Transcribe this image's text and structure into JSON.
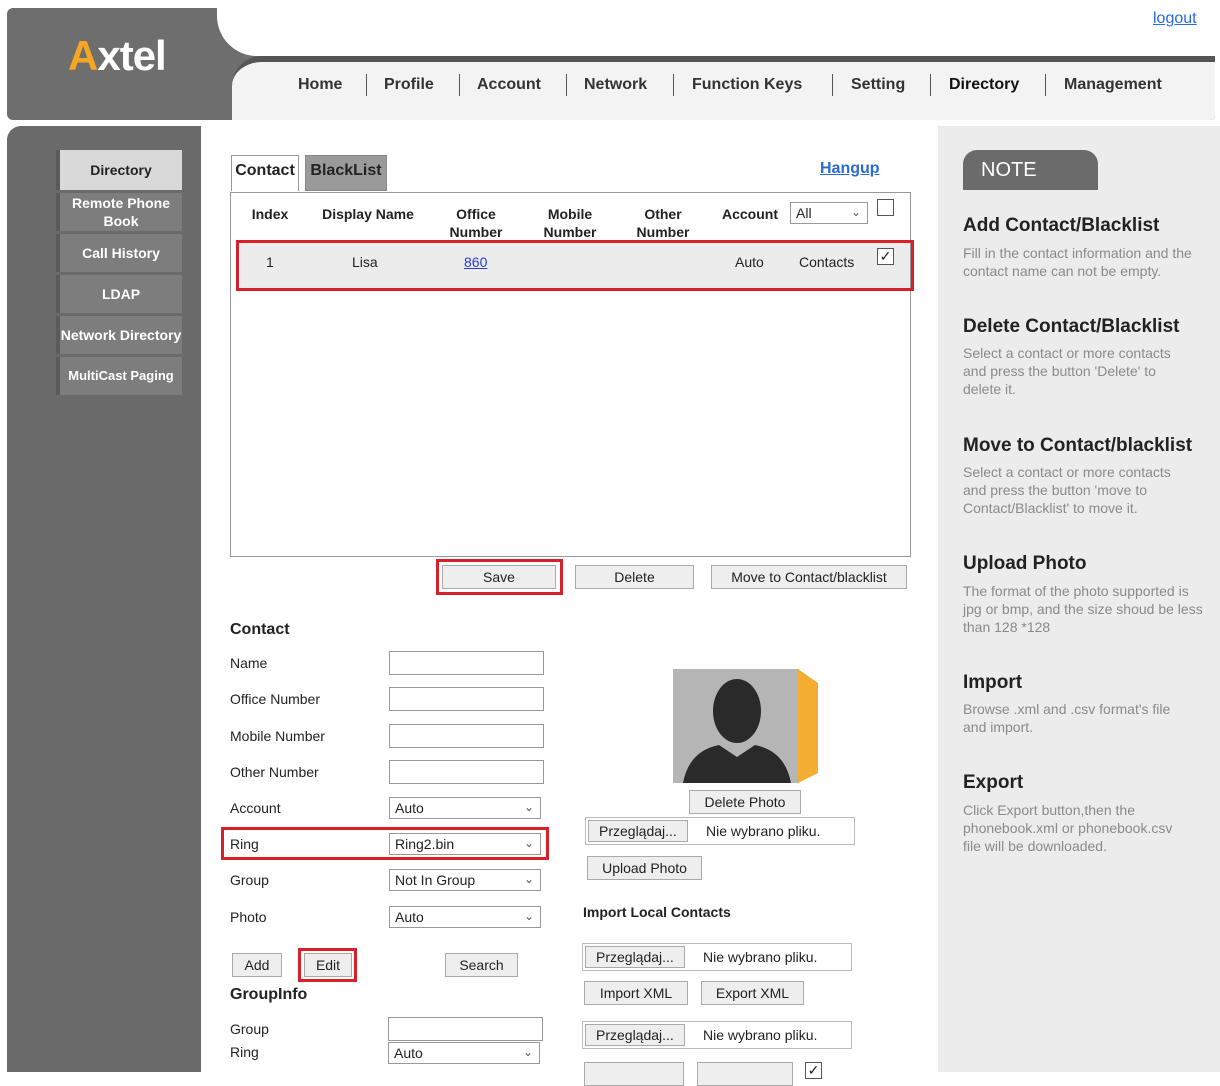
{
  "header": {
    "logo": {
      "accent": "A",
      "rest": "xtel",
      "accent_color": "#f5a623"
    },
    "logout": "logout",
    "nav": [
      "Home",
      "Profile",
      "Account",
      "Network",
      "Function Keys",
      "Setting",
      "Directory",
      "Management"
    ]
  },
  "sidebar": {
    "items": [
      {
        "label": "Directory",
        "active": true
      },
      {
        "label": "Remote Phone Book"
      },
      {
        "label": "Call History"
      },
      {
        "label": "LDAP"
      },
      {
        "label": "Network Directory"
      },
      {
        "label": "MultiCast Paging"
      }
    ]
  },
  "tabs": {
    "contact": "Contact",
    "blacklist": "BlackList",
    "hangup": "Hangup"
  },
  "table": {
    "headers": [
      "Index",
      "Display Name",
      "Office Number",
      "Mobile Number",
      "Other Number",
      "Account"
    ],
    "account_filter": "All",
    "rows": [
      {
        "index": "1",
        "name": "Lisa",
        "office": "860",
        "mobile": "",
        "other": "",
        "account": "Auto",
        "group": "Contacts",
        "checked": true
      }
    ]
  },
  "actions": {
    "save": "Save",
    "delete": "Delete",
    "move": "Move to Contact/blacklist"
  },
  "contact_form": {
    "title": "Contact",
    "name_label": "Name",
    "office_label": "Office Number",
    "mobile_label": "Mobile Number",
    "other_label": "Other Number",
    "account_label": "Account",
    "account_value": "Auto",
    "ring_label": "Ring",
    "ring_value": "Ring2.bin",
    "group_label": "Group",
    "group_value": "Not In Group",
    "photo_label": "Photo",
    "photo_value": "Auto",
    "add": "Add",
    "edit": "Edit",
    "search": "Search"
  },
  "photo": {
    "delete": "Delete Photo",
    "browse": "Przeglądaj...",
    "no_file": "Nie wybrano pliku.",
    "upload": "Upload Photo"
  },
  "import": {
    "title": "Import Local Contacts",
    "browse": "Przeglądaj...",
    "no_file": "Nie wybrano pliku.",
    "import_xml": "Import XML",
    "export_xml": "Export XML",
    "browse2": "Przeglądaj...",
    "no_file2": "Nie wybrano pliku."
  },
  "groupinfo": {
    "title": "GroupInfo",
    "group_label": "Group",
    "ring_label": "Ring",
    "ring_value": "Auto"
  },
  "note": {
    "head": "NOTE",
    "sections": [
      {
        "title": "Add Contact/Blacklist",
        "text": "Fill in the contact information and the contact name can not be empty."
      },
      {
        "title": "Delete Contact/Blacklist",
        "text": "Select a contact or more contacts and press the button 'Delete' to delete it."
      },
      {
        "title": "Move to Contact/blacklist",
        "text": "Select a contact or more contacts and press the button 'move to Contact/Blacklist' to move it."
      },
      {
        "title": "Upload Photo",
        "text": "The format of the photo supported is jpg or bmp, and the size shoud be less than 128 *128"
      },
      {
        "title": "Import",
        "text": "Browse .xml and .csv format's file and import."
      },
      {
        "title": "Export",
        "text": "Click Export button,then the phonebook.xml or phonebook.csv file will be downloaded."
      }
    ]
  }
}
